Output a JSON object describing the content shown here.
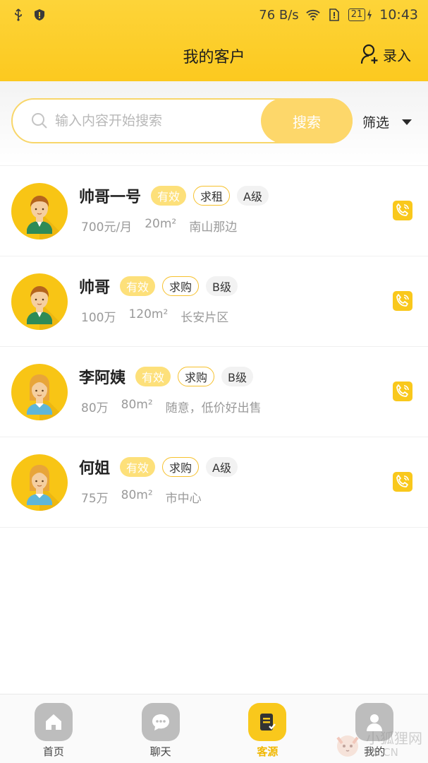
{
  "status_bar": {
    "speed": "76 B/s",
    "battery": "21",
    "time": "10:43"
  },
  "header": {
    "title": "我的客户",
    "action_label": "录入"
  },
  "search": {
    "placeholder": "输入内容开始搜索",
    "button_label": "搜索",
    "filter_label": "筛选"
  },
  "customers": [
    {
      "name": "帅哥一号",
      "status": "有效",
      "type": "求租",
      "level": "A级",
      "price": "700元/月",
      "area": "20m²",
      "location": "南山那边",
      "gender": "male"
    },
    {
      "name": "帅哥",
      "status": "有效",
      "type": "求购",
      "level": "B级",
      "price": "100万",
      "area": "120m²",
      "location": "长安片区",
      "gender": "male"
    },
    {
      "name": "李阿姨",
      "status": "有效",
      "type": "求购",
      "level": "B级",
      "price": "80万",
      "area": "80m²",
      "location": "随意，低价好出售",
      "gender": "female"
    },
    {
      "name": "何姐",
      "status": "有效",
      "type": "求购",
      "level": "A级",
      "price": "75万",
      "area": "80m²",
      "location": "市中心",
      "gender": "female"
    }
  ],
  "tabs": [
    {
      "label": "首页",
      "icon": "home-icon",
      "active": false
    },
    {
      "label": "聊天",
      "icon": "chat-icon",
      "active": false
    },
    {
      "label": "客源",
      "icon": "clients-icon",
      "active": true
    },
    {
      "label": "我的",
      "icon": "profile-icon",
      "active": false
    }
  ],
  "watermark": {
    "title": "小狐狸网",
    "sub": "KS.CN"
  },
  "colors": {
    "accent": "#fcc91f",
    "accent_light": "#fde07a",
    "tab_inactive": "#bdbdbd"
  }
}
